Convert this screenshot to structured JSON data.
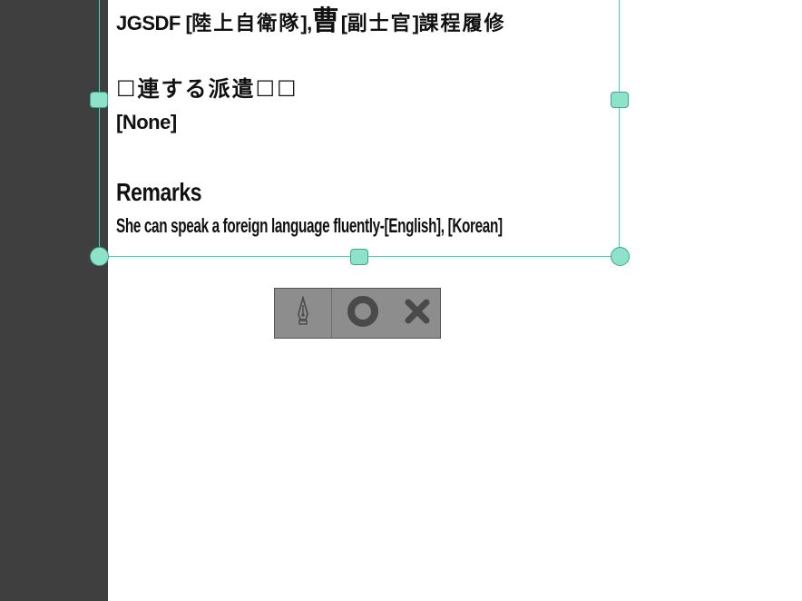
{
  "document": {
    "line1": {
      "prefix": "JGSDF [",
      "org": "陸上自衛隊",
      "mid": "], ",
      "rank_char": "曹",
      "bracket_open": " [",
      "rank_detail": "副士官",
      "bracket_close": "] ",
      "course": "課程履修"
    },
    "dispatch_heading": "☐連する派遣☐☐",
    "dispatch_value": "[None]",
    "remarks_heading": "Remarks",
    "remarks_value": "She can speak a foreign language fluently-[English], [Korean]"
  },
  "toolbar": {
    "pen_icon": "pen-nib-icon",
    "circle_icon": "circle-icon",
    "close_icon": "close-icon"
  },
  "colors": {
    "frame": "#46d6c0",
    "handle": "#8de3c8",
    "rail": "#3f3f3f",
    "toolbar": "#8d8d8d",
    "toolbar_icon": "#4a4a4a"
  }
}
